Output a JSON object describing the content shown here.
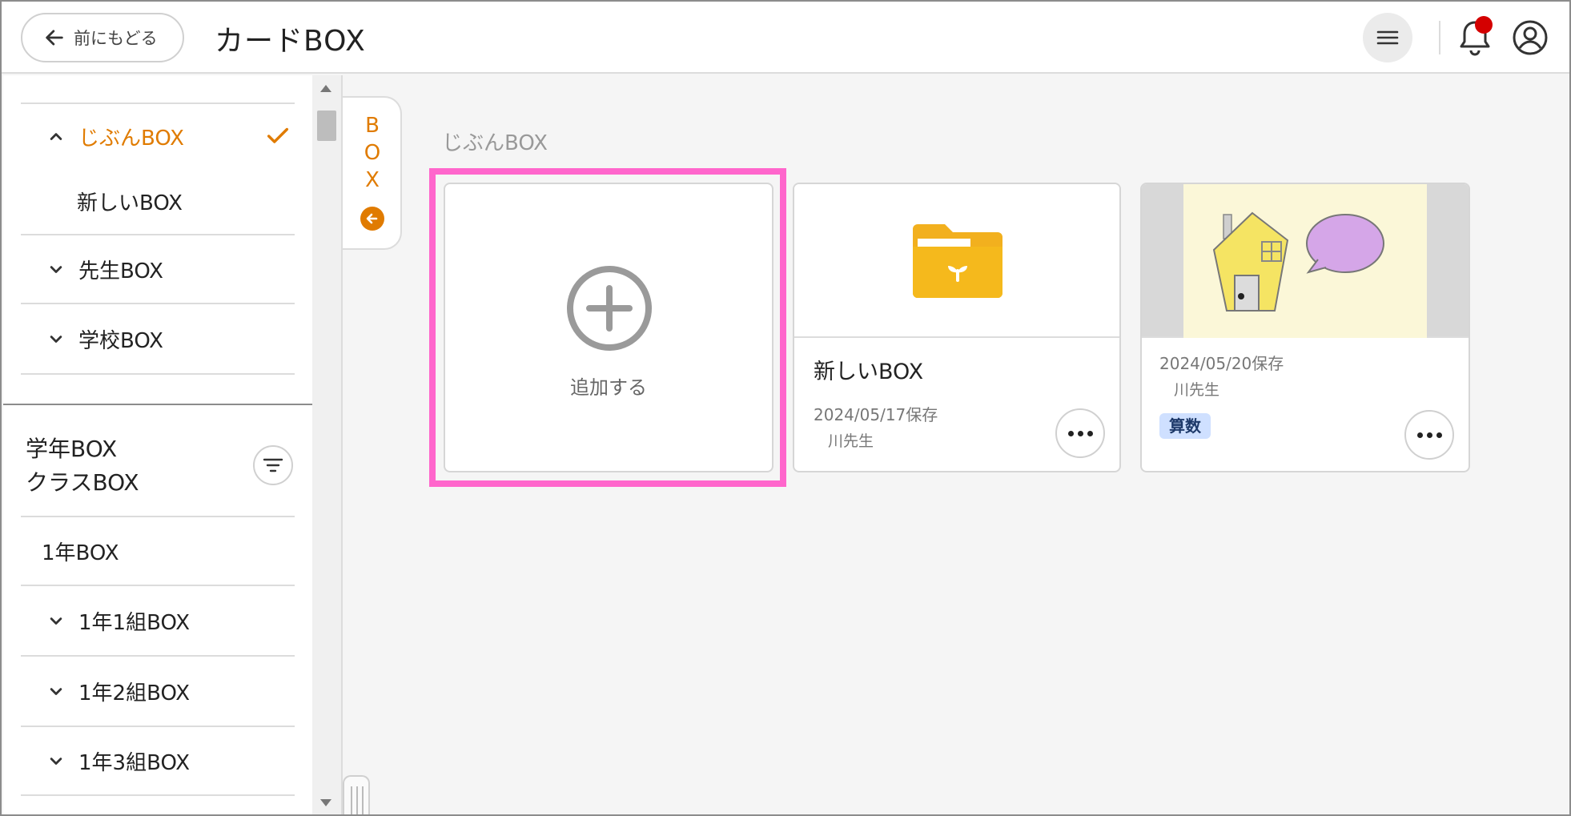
{
  "header": {
    "back_label": "前にもどる",
    "title": "カードBOX",
    "icons": {
      "back": "arrow-left-icon",
      "menu": "hamburger-menu-icon",
      "bell": "bell-icon",
      "account": "account-icon"
    },
    "notification_dot_color": "#d40000"
  },
  "sidebar": {
    "my_box": {
      "label": "じぶんBOX",
      "state": "expanded",
      "checked": true
    },
    "my_box_child": "新しいBOX",
    "teacher_box": "先生BOX",
    "school_box": "学校BOX",
    "grade_section_title_line1": "学年BOX",
    "grade_section_title_line2": "クラスBOX",
    "grade_items": [
      {
        "label": "1年BOX"
      },
      {
        "label": "1年1組BOX"
      },
      {
        "label": "1年2組BOX"
      },
      {
        "label": "1年3組BOX"
      }
    ],
    "accent_color": "#e07b00"
  },
  "box_tab": {
    "letters": [
      "B",
      "O",
      "X"
    ]
  },
  "main": {
    "section_label": "じぶんBOX",
    "add_card_label": "追加する",
    "cards": [
      {
        "name": "新しいBOX",
        "date": "2024/05/17保存",
        "teacher": "川先生",
        "thumbnail": "folder-icon"
      },
      {
        "date": "2024/05/20保存",
        "teacher": "川先生",
        "tag": "算数",
        "thumbnail": "house-drawing"
      }
    ],
    "highlight_color": "#ff66cc"
  }
}
